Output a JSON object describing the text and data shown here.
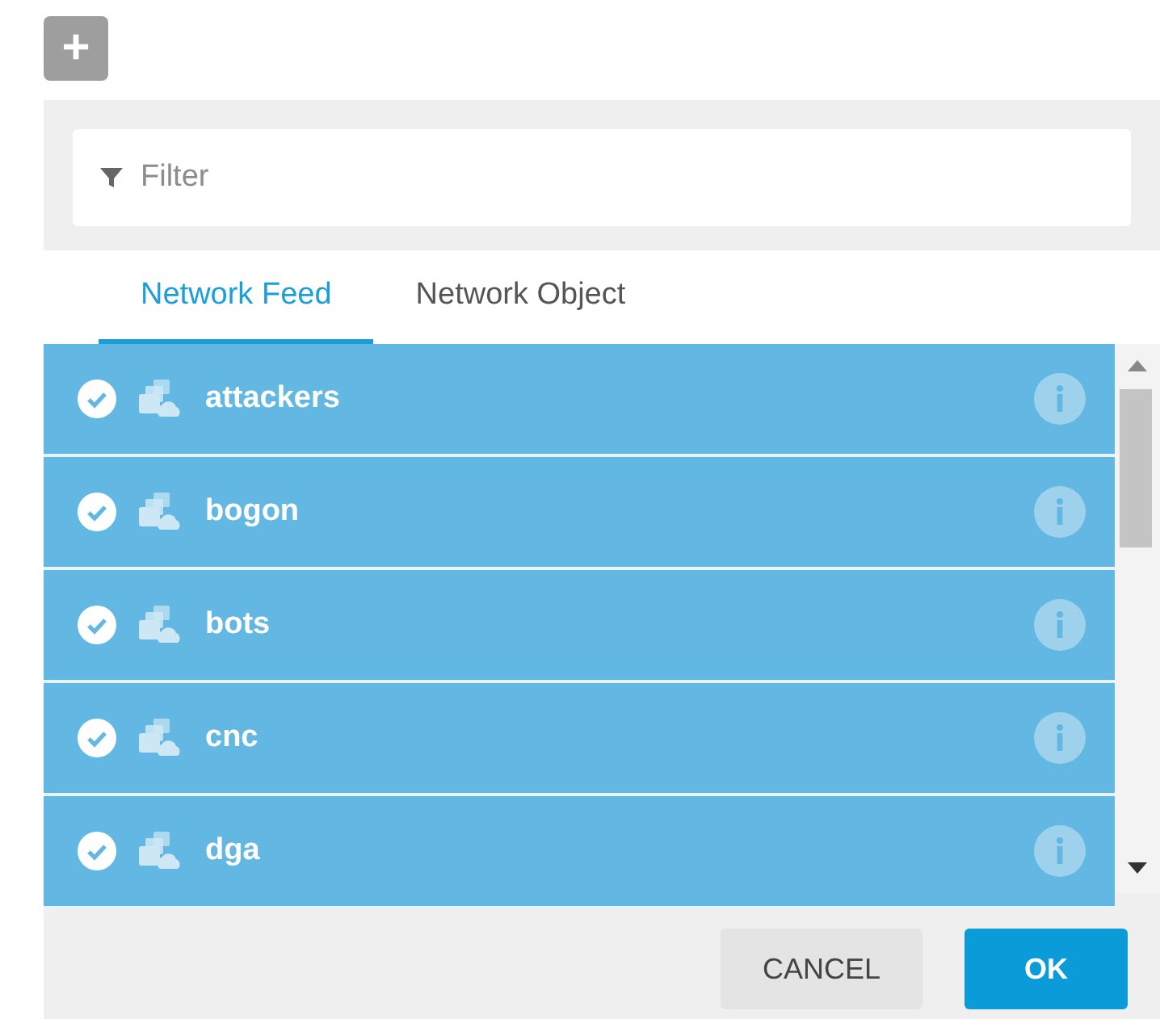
{
  "add_button": {
    "label": "+"
  },
  "filter": {
    "placeholder": "Filter"
  },
  "tabs": [
    {
      "label": "Network Feed",
      "selected": true
    },
    {
      "label": "Network Object",
      "selected": false
    }
  ],
  "items": [
    {
      "name": "attackers",
      "selected": true
    },
    {
      "name": "bogon",
      "selected": true
    },
    {
      "name": "bots",
      "selected": true
    },
    {
      "name": "cnc",
      "selected": true
    },
    {
      "name": "dga",
      "selected": true
    }
  ],
  "buttons": [
    {
      "label": "CANCEL",
      "kind": "secondary"
    },
    {
      "label": "OK",
      "kind": "primary"
    }
  ]
}
